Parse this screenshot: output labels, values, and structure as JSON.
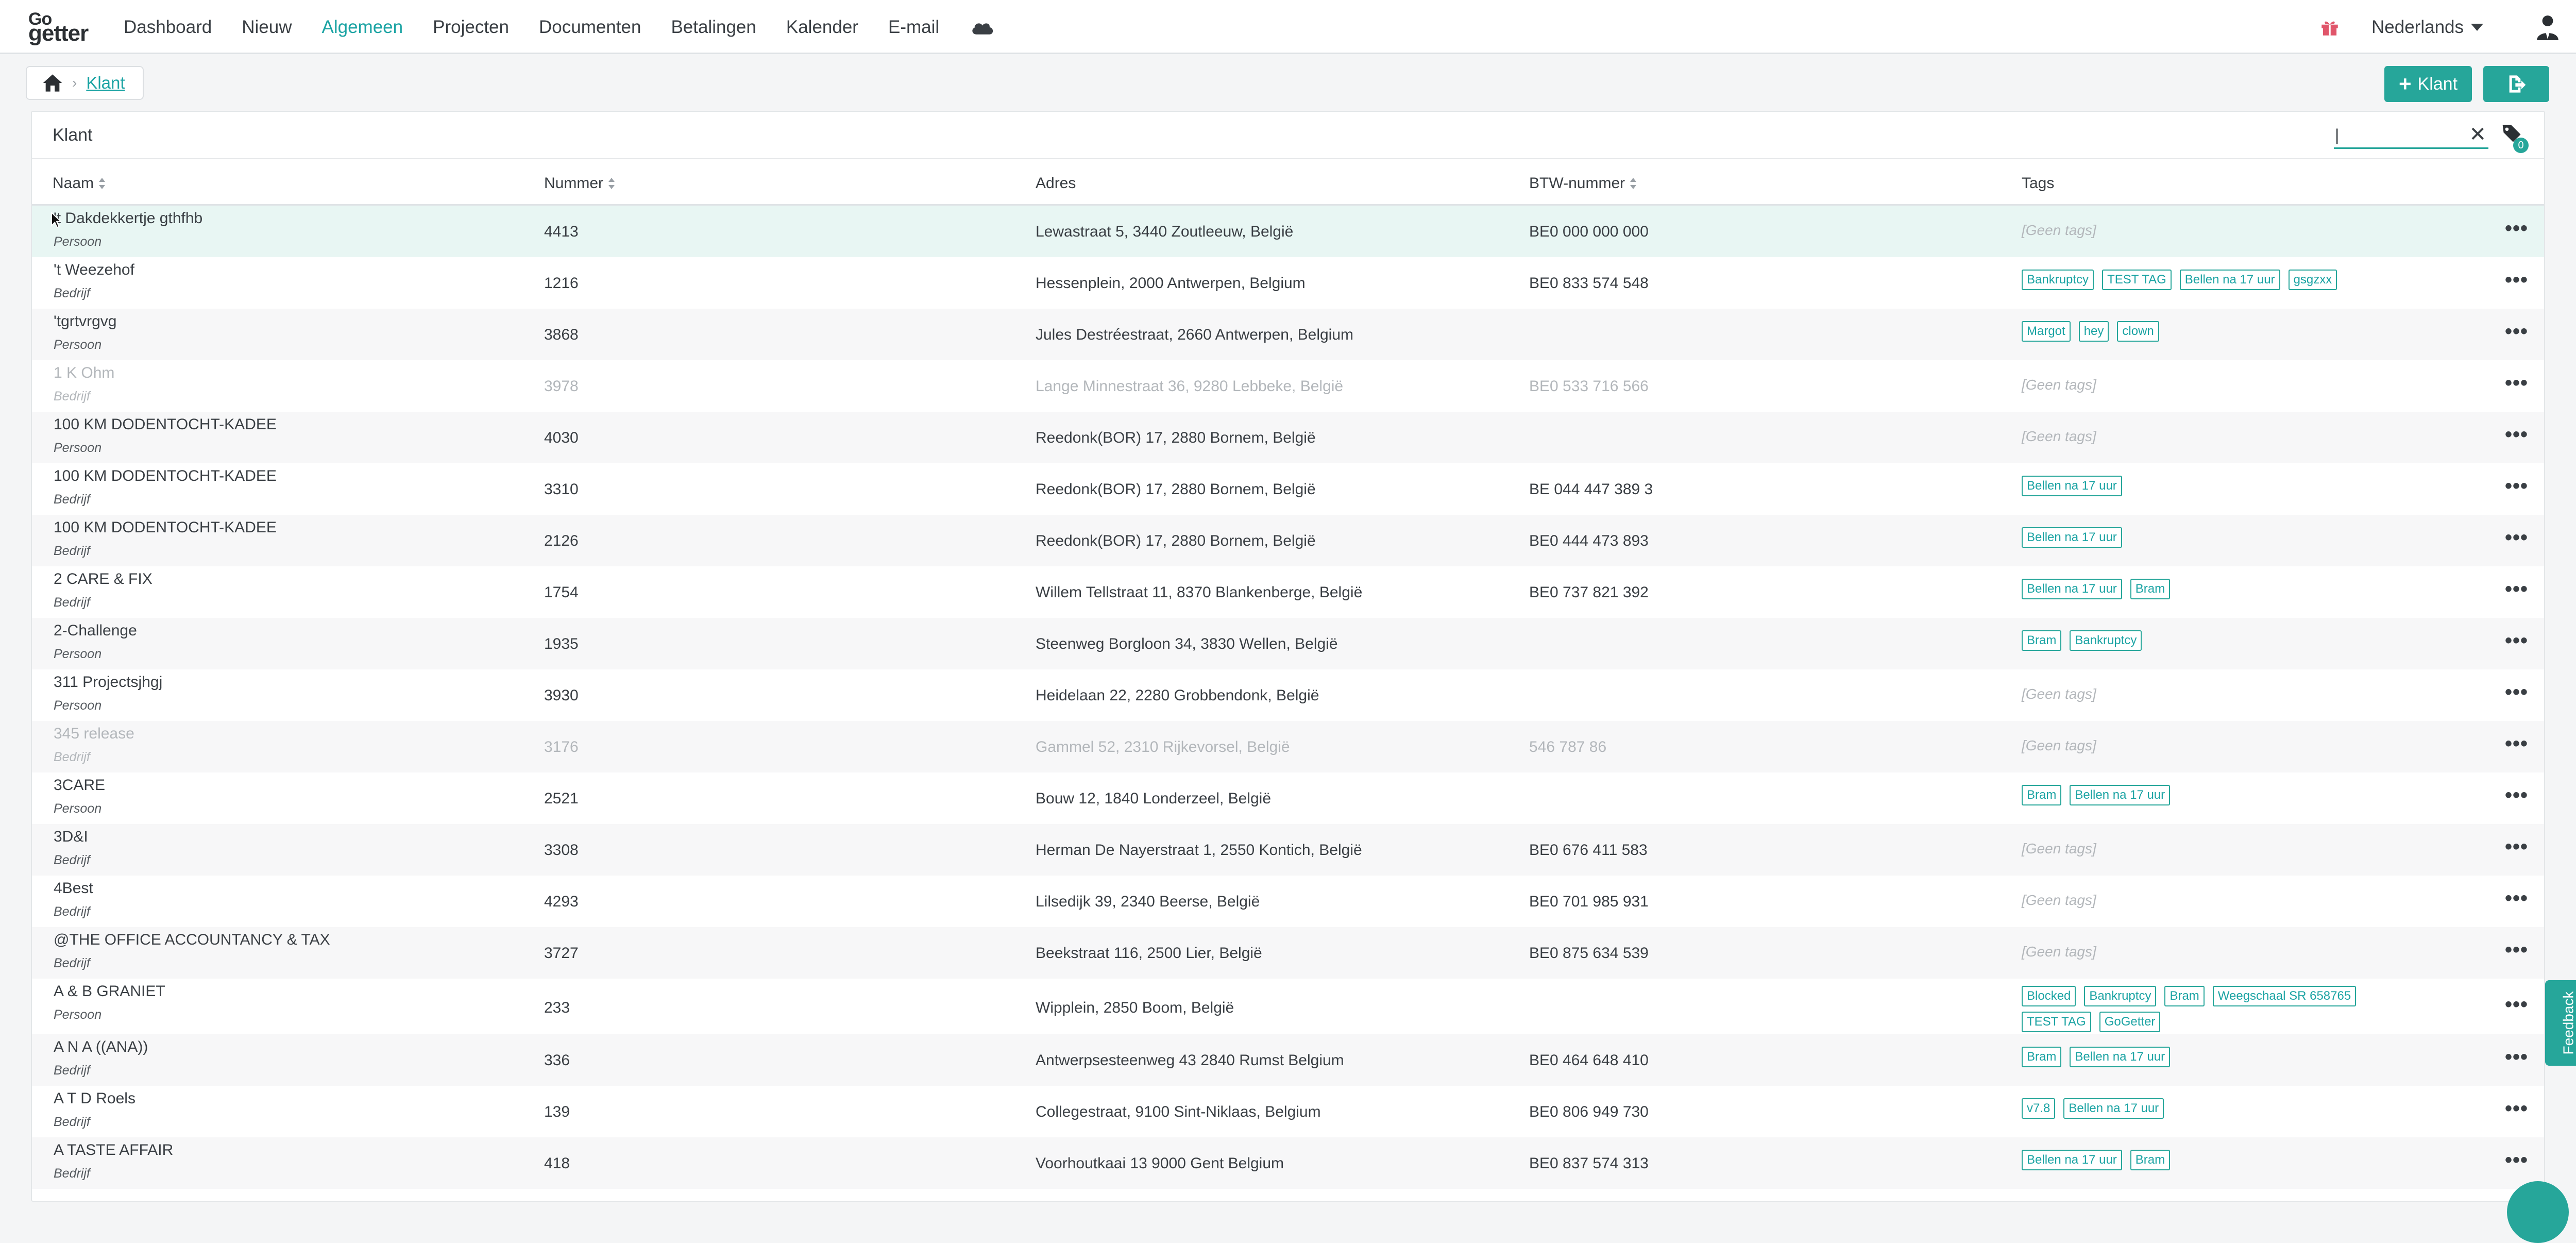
{
  "nav": {
    "logo": {
      "go": "Go",
      "getter": "getter"
    },
    "items": [
      "Dashboard",
      "Nieuw",
      "Algemeen",
      "Projecten",
      "Documenten",
      "Betalingen",
      "Kalender",
      "E-mail"
    ],
    "active_index": 2,
    "language": "Nederlands",
    "icons": [
      "cloud-icon",
      "gift-icon",
      "user-icon"
    ],
    "accent_color": "#1aa3a3"
  },
  "breadcrumb": {
    "current": "Klant"
  },
  "toolbar": {
    "add_label": "Klant"
  },
  "card": {
    "title": "Klant",
    "search_value": "|",
    "tag_filter_count": "0"
  },
  "columns": [
    "Naam",
    "Nummer",
    "Adres",
    "BTW-nummer",
    "Tags"
  ],
  "rows": [
    {
      "name": "'t Dakdekkertje gthfhb",
      "type": "Persoon",
      "number": "4413",
      "address": "Lewastraat 5, 3440 Zoutleeuw, België",
      "vat": "BE0 000 000 000",
      "tags": [],
      "inactive": false
    },
    {
      "name": "'t Weezehof",
      "type": "Bedrijf",
      "number": "1216",
      "address": "Hessenplein, 2000 Antwerpen, Belgium",
      "vat": "BE0 833 574 548",
      "tags": [
        "Bankruptcy",
        "TEST TAG",
        "Bellen na 17 uur",
        "gsgzxx"
      ],
      "inactive": false
    },
    {
      "name": "'tgrtvrgvg",
      "type": "Persoon",
      "number": "3868",
      "address": "Jules Destréestraat, 2660 Antwerpen, Belgium",
      "vat": "",
      "tags": [
        "Margot",
        "hey",
        "clown"
      ],
      "inactive": false
    },
    {
      "name": "1 K Ohm",
      "type": "Bedrijf",
      "number": "3978",
      "address": "Lange Minnestraat 36, 9280 Lebbeke, België",
      "vat": "BE0 533 716 566",
      "tags": [],
      "inactive": true
    },
    {
      "name": "100 KM DODENTOCHT-KADEE",
      "type": "Persoon",
      "number": "4030",
      "address": "Reedonk(BOR) 17, 2880 Bornem, België",
      "vat": "",
      "tags": [],
      "inactive": false
    },
    {
      "name": "100 KM DODENTOCHT-KADEE",
      "type": "Bedrijf",
      "number": "3310",
      "address": "Reedonk(BOR) 17, 2880 Bornem, België",
      "vat": "BE 044 447 389 3",
      "tags": [
        "Bellen na 17 uur"
      ],
      "inactive": false
    },
    {
      "name": "100 KM DODENTOCHT-KADEE",
      "type": "Bedrijf",
      "number": "2126",
      "address": "Reedonk(BOR) 17, 2880 Bornem, België",
      "vat": "BE0 444 473 893",
      "tags": [
        "Bellen na 17 uur"
      ],
      "inactive": false
    },
    {
      "name": "2 CARE & FIX",
      "type": "Bedrijf",
      "number": "1754",
      "address": "Willem Tellstraat 11, 8370 Blankenberge, België",
      "vat": "BE0 737 821 392",
      "tags": [
        "Bellen na 17 uur",
        "Bram"
      ],
      "inactive": false
    },
    {
      "name": "2-Challenge",
      "type": "Persoon",
      "number": "1935",
      "address": "Steenweg Borgloon 34, 3830 Wellen, België",
      "vat": "",
      "tags": [
        "Bram",
        "Bankruptcy"
      ],
      "inactive": false
    },
    {
      "name": "311 Projectsjhgj",
      "type": "Persoon",
      "number": "3930",
      "address": "Heidelaan 22, 2280 Grobbendonk, België",
      "vat": "",
      "tags": [],
      "inactive": false
    },
    {
      "name": "345 release",
      "type": "Bedrijf",
      "number": "3176",
      "address": "Gammel 52, 2310 Rijkevorsel, België",
      "vat": "546 787 86",
      "tags": [],
      "inactive": true
    },
    {
      "name": "3CARE",
      "type": "Persoon",
      "number": "2521",
      "address": "Bouw 12, 1840 Londerzeel, België",
      "vat": "",
      "tags": [
        "Bram",
        "Bellen na 17 uur"
      ],
      "inactive": false
    },
    {
      "name": "3D&I",
      "type": "Bedrijf",
      "number": "3308",
      "address": "Herman De Nayerstraat 1, 2550 Kontich, België",
      "vat": "BE0 676 411 583",
      "tags": [],
      "inactive": false
    },
    {
      "name": "4Best",
      "type": "Bedrijf",
      "number": "4293",
      "address": "Lilsedijk 39, 2340 Beerse, België",
      "vat": "BE0 701 985 931",
      "tags": [],
      "inactive": false
    },
    {
      "name": "@THE OFFICE ACCOUNTANCY & TAX",
      "type": "Bedrijf",
      "number": "3727",
      "address": "Beekstraat 116, 2500 Lier, België",
      "vat": "BE0 875 634 539",
      "tags": [],
      "inactive": false
    },
    {
      "name": "A & B GRANIET",
      "type": "Persoon",
      "number": "233",
      "address": "Wipplein, 2850 Boom, België",
      "vat": "",
      "tags": [
        "Blocked",
        "Bankruptcy",
        "Bram",
        "Weegschaal SR 658765",
        "TEST TAG",
        "GoGetter"
      ],
      "inactive": false
    },
    {
      "name": "A N A ((ANA))",
      "type": "Bedrijf",
      "number": "336",
      "address": "Antwerpsesteenweg 43 2840 Rumst Belgium",
      "vat": "BE0 464 648 410",
      "tags": [
        "Bram",
        "Bellen na 17 uur"
      ],
      "inactive": false
    },
    {
      "name": "A T D Roels",
      "type": "Bedrijf",
      "number": "139",
      "address": "Collegestraat, 9100 Sint-Niklaas, Belgium",
      "vat": "BE0 806 949 730",
      "tags": [
        "v7.8",
        "Bellen na 17 uur"
      ],
      "inactive": false
    },
    {
      "name": "A TASTE AFFAIR",
      "type": "Bedrijf",
      "number": "418",
      "address": "Voorhoutkaai 13 9000 Gent Belgium",
      "vat": "BE0 837 574 313",
      "tags": [
        "Bellen na 17 uur",
        "Bram"
      ],
      "inactive": false
    }
  ],
  "labels": {
    "no_tags": "[Geen tags]",
    "row_menu": "•••"
  },
  "feedback_label": "Feedback"
}
